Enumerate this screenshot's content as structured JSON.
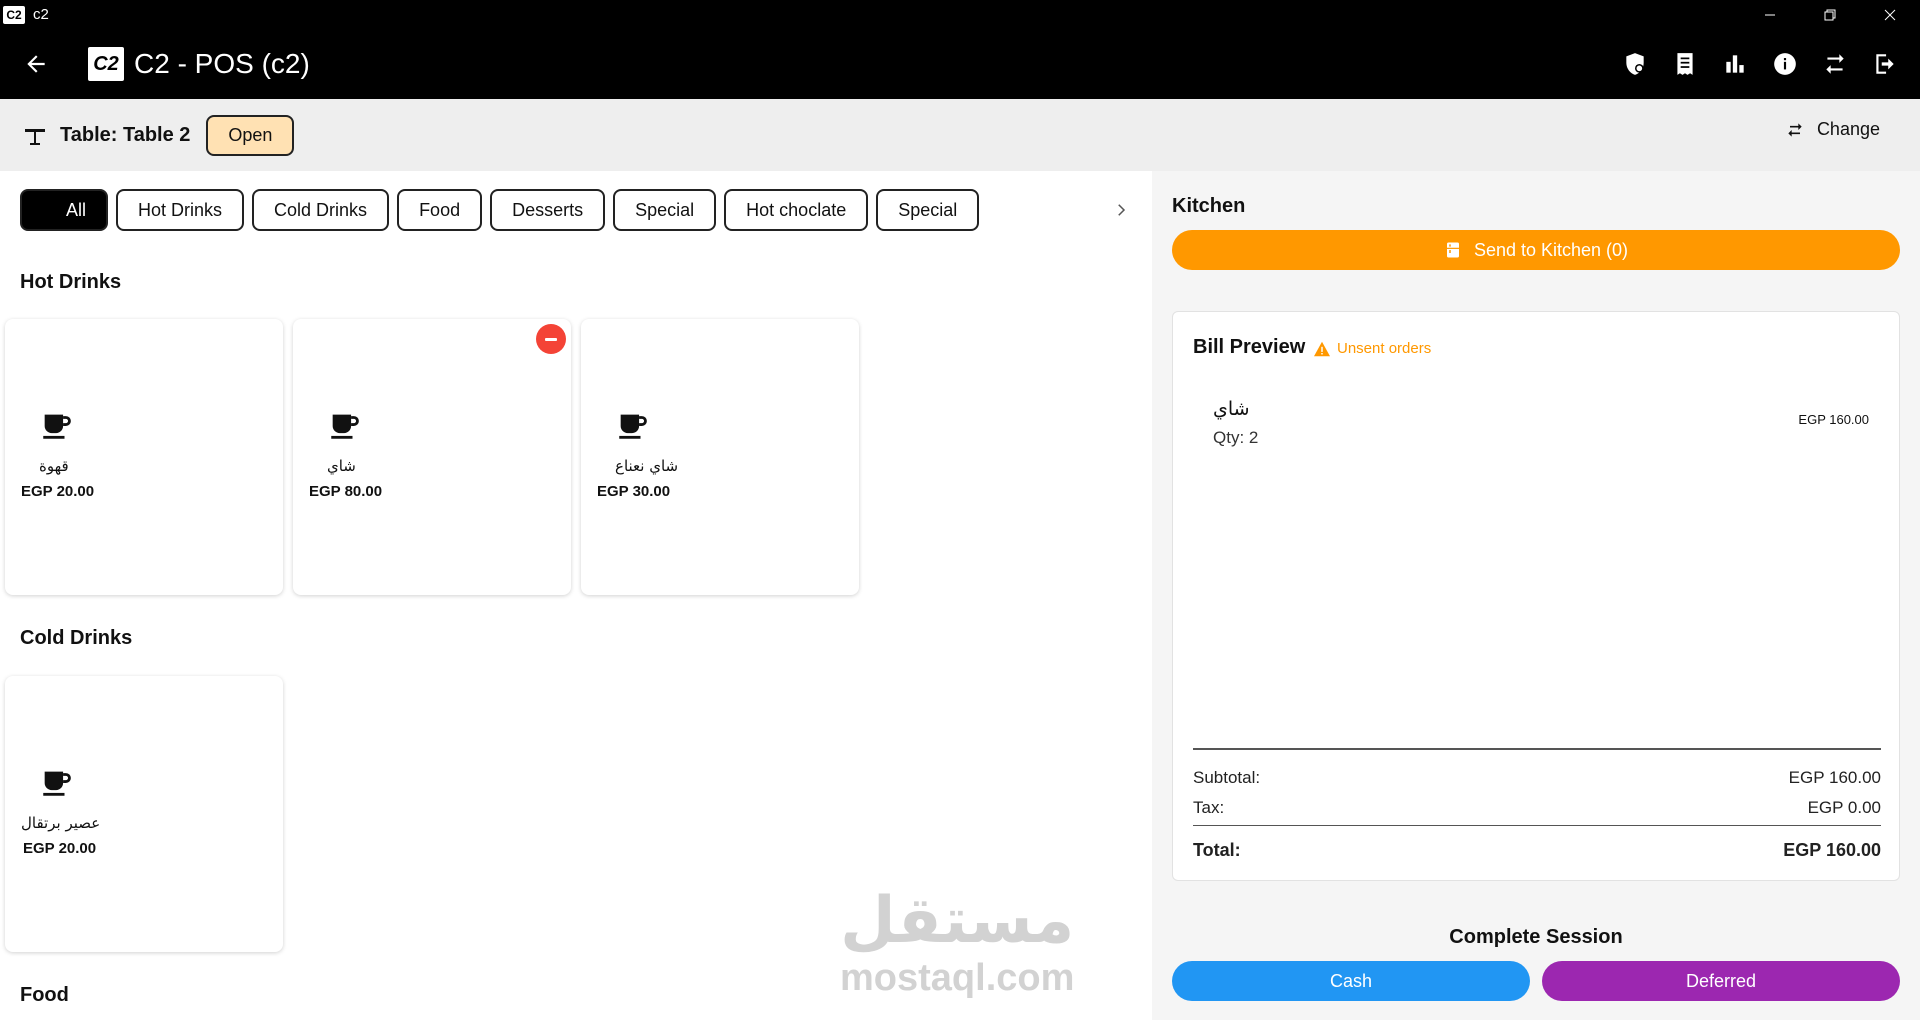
{
  "window": {
    "title": "c2",
    "logo_text": "C2"
  },
  "appbar": {
    "logo_text": "C2",
    "title": "C2 - POS (c2)"
  },
  "tablebar": {
    "table_label": "Table: Table 2",
    "status": "Open",
    "change_label": "Change"
  },
  "categories": [
    "All",
    "Hot Drinks",
    "Cold Drinks",
    "Food",
    "Desserts",
    "Special",
    "Hot choclate",
    "Special"
  ],
  "sections": {
    "hot_drinks": {
      "title": "Hot Drinks",
      "products": [
        {
          "name": "قهوة",
          "price": "EGP 20.00"
        },
        {
          "name": "شاي",
          "price": "EGP 80.00"
        },
        {
          "name": "شاي نعناع",
          "price": "EGP 30.00"
        }
      ]
    },
    "cold_drinks": {
      "title": "Cold Drinks",
      "products": [
        {
          "name": "عصير برتقال",
          "price": "EGP 20.00"
        }
      ]
    },
    "food": {
      "title": "Food"
    }
  },
  "kitchen": {
    "title": "Kitchen",
    "send_label": "Send to Kitchen (0)"
  },
  "bill": {
    "title": "Bill Preview",
    "warning": "Unsent orders",
    "items": [
      {
        "name": "شاي",
        "qty": "Qty: 2",
        "price": "EGP 160.00"
      }
    ],
    "subtotal_label": "Subtotal:",
    "subtotal": "EGP 160.00",
    "tax_label": "Tax:",
    "tax": "EGP 0.00",
    "total_label": "Total:",
    "total": "EGP 160.00"
  },
  "session": {
    "title": "Complete Session",
    "cash_label": "Cash",
    "deferred_label": "Deferred"
  },
  "watermark": {
    "arabic": "مستقل",
    "latin": "mostaql.com"
  },
  "colors": {
    "orange": "#ff9800",
    "blue": "#2196f3",
    "purple": "#9c27b0",
    "red": "#f44336",
    "badge": "#ffe1b3"
  }
}
